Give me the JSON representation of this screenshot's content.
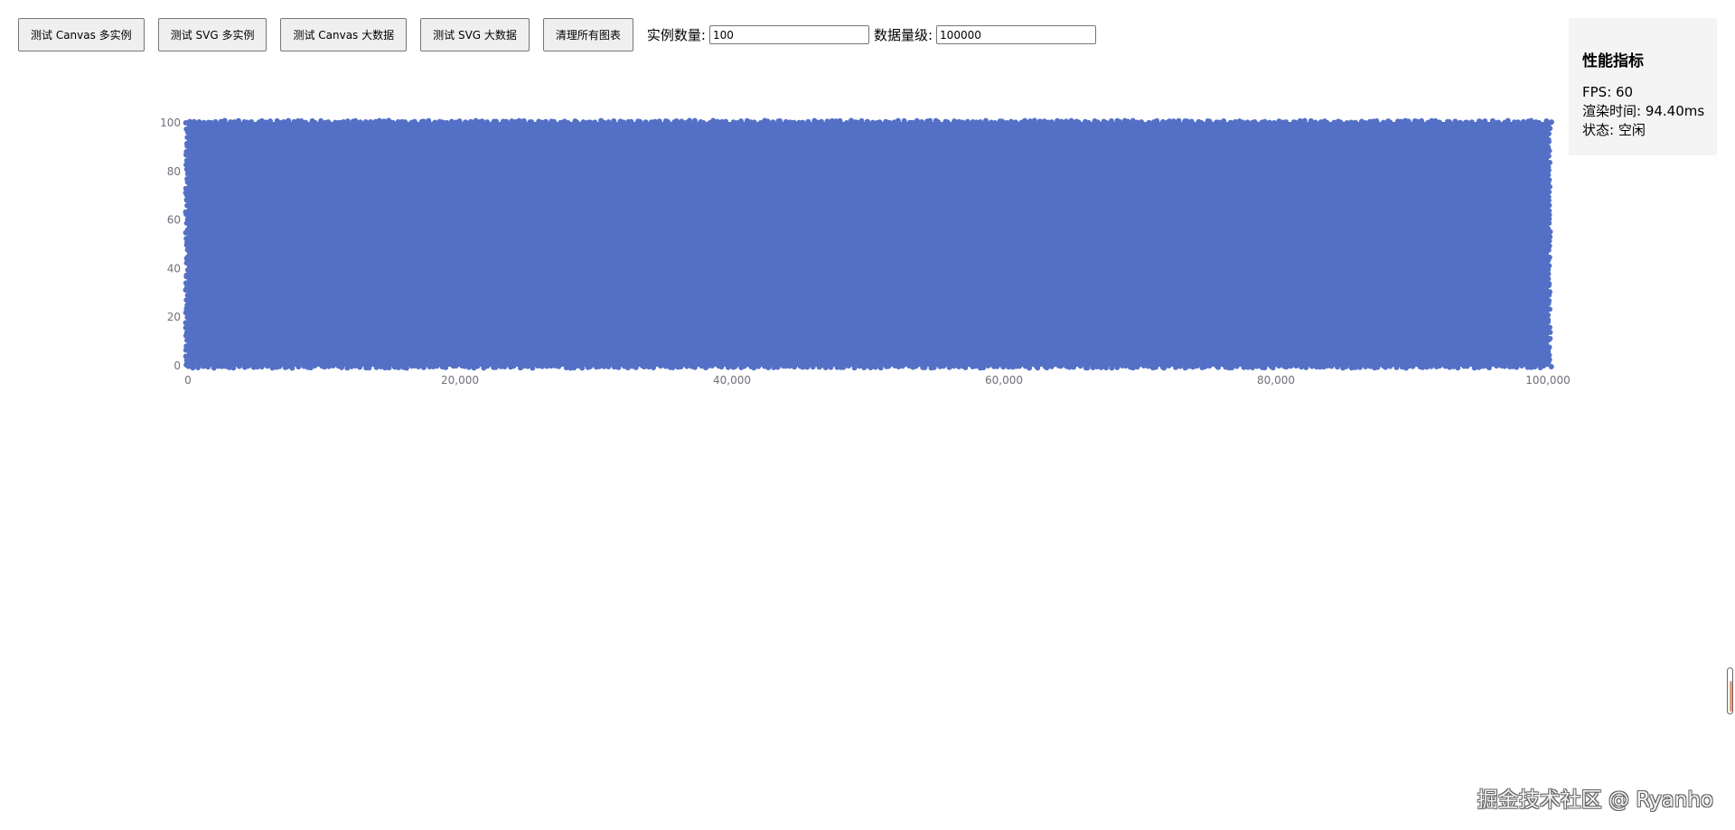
{
  "toolbar": {
    "buttons": [
      {
        "label": "测试 Canvas 多实例"
      },
      {
        "label": "测试 SVG 多实例"
      },
      {
        "label": "测试 Canvas 大数据"
      },
      {
        "label": "测试 SVG 大数据"
      },
      {
        "label": "清理所有图表"
      }
    ],
    "instance_count_label": "实例数量:",
    "instance_count_value": "100",
    "data_size_label": "数据量级:",
    "data_size_value": "100000"
  },
  "perf": {
    "title": "性能指标",
    "fps": "FPS: 60",
    "render_time": "渲染时间: 94.40ms",
    "status": "状态: 空闲"
  },
  "chart_data": {
    "type": "scatter",
    "title": "",
    "xlabel": "",
    "ylabel": "",
    "xlim": [
      0,
      100000
    ],
    "ylim": [
      0,
      100
    ],
    "xticks": [
      "0",
      "20,000",
      "40,000",
      "60,000",
      "80,000",
      "100,000"
    ],
    "xtick_values": [
      0,
      20000,
      40000,
      60000,
      80000,
      100000
    ],
    "yticks": [
      "0",
      "20",
      "40",
      "60",
      "80",
      "100"
    ],
    "ytick_values": [
      0,
      20,
      40,
      60,
      80,
      100
    ],
    "series": [
      {
        "point_count": 100000,
        "x_range": [
          0,
          100000
        ],
        "y_range": [
          0,
          100
        ]
      }
    ],
    "color": "#5470c6",
    "grid": false,
    "legend": "none"
  },
  "watermark": "掘金技术社区 @ Ryanho",
  "colors": {
    "series": "#5470c6",
    "axis_text": "#6e7079",
    "panel_bg": "#f4f4f4"
  }
}
